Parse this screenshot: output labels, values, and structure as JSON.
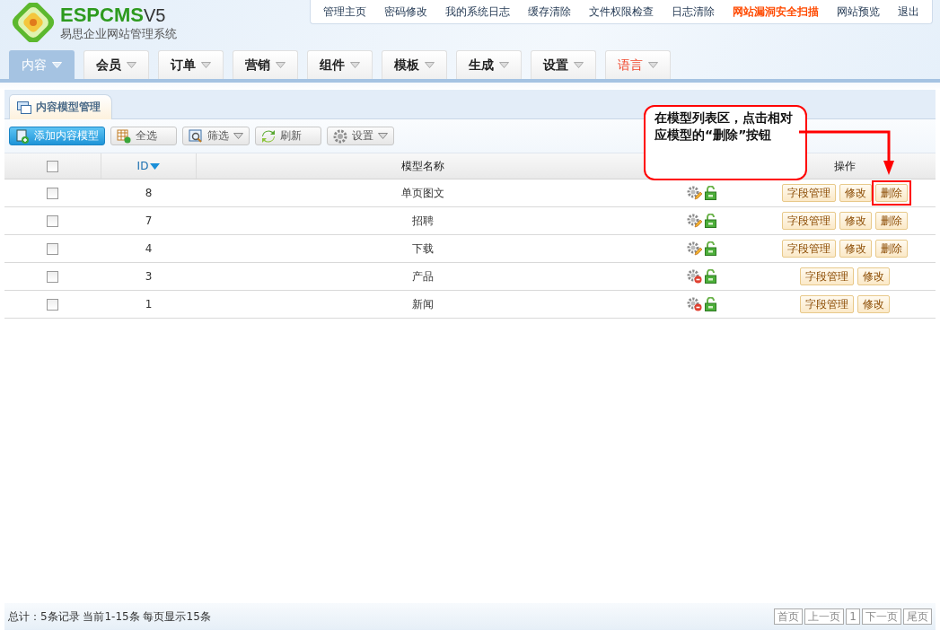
{
  "logo": {
    "brand": "ESPCMS",
    "version": "V5",
    "subtitle": "易思企业网站管理系统"
  },
  "top_links": [
    {
      "label": "管理主页",
      "highlighted": false
    },
    {
      "label": "密码修改",
      "highlighted": false
    },
    {
      "label": "我的系统日志",
      "highlighted": false
    },
    {
      "label": "缓存清除",
      "highlighted": false
    },
    {
      "label": "文件权限检查",
      "highlighted": false
    },
    {
      "label": "日志清除",
      "highlighted": false
    },
    {
      "label": "网站漏洞安全扫描",
      "highlighted": true
    },
    {
      "label": "网站预览",
      "highlighted": false
    },
    {
      "label": "退出",
      "highlighted": false
    }
  ],
  "nav_tabs": [
    {
      "label": "内容",
      "selected": true,
      "highlighted": false
    },
    {
      "label": "会员",
      "selected": false,
      "highlighted": false
    },
    {
      "label": "订单",
      "selected": false,
      "highlighted": false
    },
    {
      "label": "营销",
      "selected": false,
      "highlighted": false
    },
    {
      "label": "组件",
      "selected": false,
      "highlighted": false
    },
    {
      "label": "模板",
      "selected": false,
      "highlighted": false
    },
    {
      "label": "生成",
      "selected": false,
      "highlighted": false
    },
    {
      "label": "设置",
      "selected": false,
      "highlighted": false
    },
    {
      "label": "语言",
      "selected": false,
      "highlighted": true
    }
  ],
  "panel_tab": "内容模型管理",
  "toolbar": [
    {
      "kind": "primary",
      "label": "添加内容模型"
    },
    {
      "kind": "plain",
      "label": "全选"
    },
    {
      "kind": "dropdown",
      "label": "筛选"
    },
    {
      "kind": "plain",
      "label": "刷新"
    },
    {
      "kind": "dropdown",
      "label": "设置"
    }
  ],
  "table": {
    "columns": [
      "ID",
      "模型名称",
      "操作"
    ],
    "select_all_checked": false,
    "rows": [
      {
        "checked": false,
        "id": "8",
        "name": "单页图文",
        "system": false,
        "buttons": [
          "字段管理",
          "修改",
          "删除"
        ],
        "highlighted": true
      },
      {
        "checked": false,
        "id": "7",
        "name": "招聘",
        "system": false,
        "buttons": [
          "字段管理",
          "修改",
          "删除"
        ],
        "highlighted": false
      },
      {
        "checked": false,
        "id": "4",
        "name": "下载",
        "system": false,
        "buttons": [
          "字段管理",
          "修改",
          "删除"
        ],
        "highlighted": false
      },
      {
        "checked": false,
        "id": "3",
        "name": "产品",
        "system": true,
        "buttons": [
          "字段管理",
          "修改"
        ],
        "highlighted": false
      },
      {
        "checked": false,
        "id": "1",
        "name": "新闻",
        "system": true,
        "buttons": [
          "字段管理",
          "修改"
        ],
        "highlighted": false
      }
    ]
  },
  "callout": "在模型列表区，点击相对应模型的“删除”按钮",
  "footer": {
    "summary": "总计：5条记录 当前1-15条 每页显示15条",
    "pager": [
      "首页",
      "上一页",
      "1",
      "下一页",
      "尾页"
    ]
  }
}
